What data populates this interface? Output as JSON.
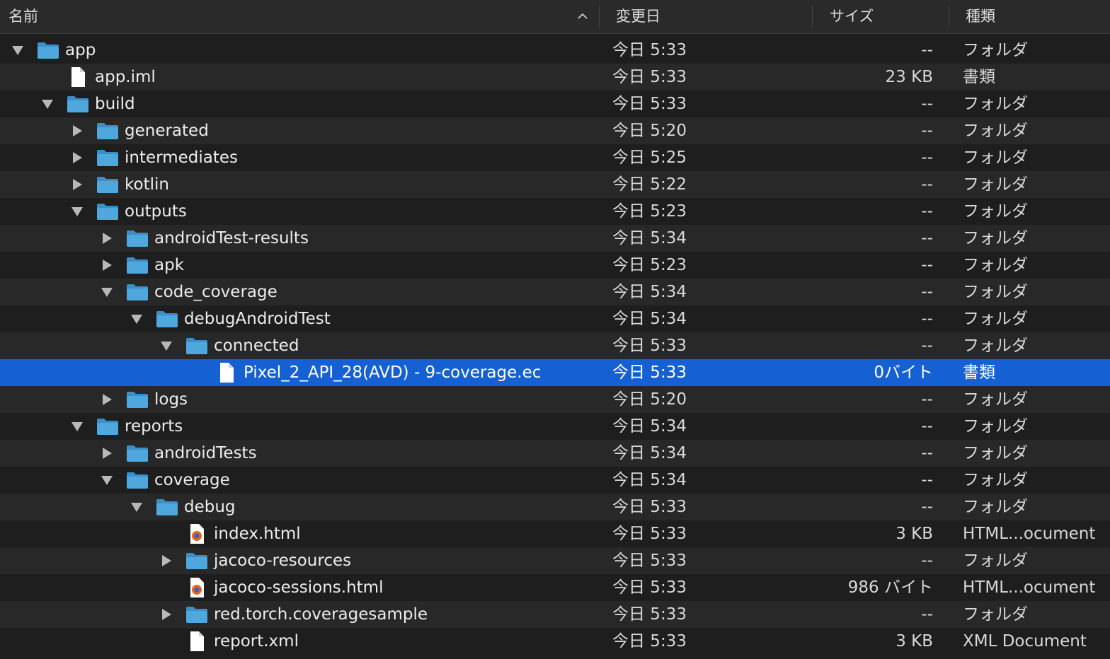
{
  "columns": {
    "name": "名前",
    "date": "変更日",
    "size": "サイズ",
    "kind": "種類"
  },
  "rows": [
    {
      "name": "app",
      "depth": 0,
      "icon": "folder-icon",
      "disclosure": "expanded",
      "date": "今日 5:33",
      "size": "--",
      "kind": "フォルダ"
    },
    {
      "name": "app.iml",
      "depth": 1,
      "icon": "document-icon",
      "disclosure": "none",
      "date": "今日 5:33",
      "size": "23 KB",
      "kind": "書類"
    },
    {
      "name": "build",
      "depth": 1,
      "icon": "folder-icon",
      "disclosure": "expanded",
      "date": "今日 5:33",
      "size": "--",
      "kind": "フォルダ"
    },
    {
      "name": "generated",
      "depth": 2,
      "icon": "folder-icon",
      "disclosure": "collapsed",
      "date": "今日 5:20",
      "size": "--",
      "kind": "フォルダ"
    },
    {
      "name": "intermediates",
      "depth": 2,
      "icon": "folder-icon",
      "disclosure": "collapsed",
      "date": "今日 5:25",
      "size": "--",
      "kind": "フォルダ"
    },
    {
      "name": "kotlin",
      "depth": 2,
      "icon": "folder-icon",
      "disclosure": "collapsed",
      "date": "今日 5:22",
      "size": "--",
      "kind": "フォルダ"
    },
    {
      "name": "outputs",
      "depth": 2,
      "icon": "folder-icon",
      "disclosure": "expanded",
      "date": "今日 5:23",
      "size": "--",
      "kind": "フォルダ"
    },
    {
      "name": "androidTest-results",
      "depth": 3,
      "icon": "folder-icon",
      "disclosure": "collapsed",
      "date": "今日 5:34",
      "size": "--",
      "kind": "フォルダ"
    },
    {
      "name": "apk",
      "depth": 3,
      "icon": "folder-icon",
      "disclosure": "collapsed",
      "date": "今日 5:23",
      "size": "--",
      "kind": "フォルダ"
    },
    {
      "name": "code_coverage",
      "depth": 3,
      "icon": "folder-icon",
      "disclosure": "expanded",
      "date": "今日 5:34",
      "size": "--",
      "kind": "フォルダ"
    },
    {
      "name": "debugAndroidTest",
      "depth": 4,
      "icon": "folder-icon",
      "disclosure": "expanded",
      "date": "今日 5:34",
      "size": "--",
      "kind": "フォルダ"
    },
    {
      "name": "connected",
      "depth": 5,
      "icon": "folder-icon",
      "disclosure": "expanded",
      "date": "今日 5:33",
      "size": "--",
      "kind": "フォルダ"
    },
    {
      "name": "Pixel_2_API_28(AVD) - 9-coverage.ec",
      "depth": 6,
      "icon": "document-icon",
      "disclosure": "none",
      "date": "今日 5:33",
      "size": "0バイト",
      "kind": "書類",
      "selected": true
    },
    {
      "name": "logs",
      "depth": 3,
      "icon": "folder-icon",
      "disclosure": "collapsed",
      "date": "今日 5:20",
      "size": "--",
      "kind": "フォルダ"
    },
    {
      "name": "reports",
      "depth": 2,
      "icon": "folder-icon",
      "disclosure": "expanded",
      "date": "今日 5:34",
      "size": "--",
      "kind": "フォルダ"
    },
    {
      "name": "androidTests",
      "depth": 3,
      "icon": "folder-icon",
      "disclosure": "collapsed",
      "date": "今日 5:34",
      "size": "--",
      "kind": "フォルダ"
    },
    {
      "name": "coverage",
      "depth": 3,
      "icon": "folder-icon",
      "disclosure": "expanded",
      "date": "今日 5:34",
      "size": "--",
      "kind": "フォルダ"
    },
    {
      "name": "debug",
      "depth": 4,
      "icon": "folder-icon",
      "disclosure": "expanded",
      "date": "今日 5:33",
      "size": "--",
      "kind": "フォルダ"
    },
    {
      "name": "index.html",
      "depth": 5,
      "icon": "firefox-html-icon",
      "disclosure": "none",
      "date": "今日 5:33",
      "size": "3 KB",
      "kind": "HTML...ocument"
    },
    {
      "name": "jacoco-resources",
      "depth": 5,
      "icon": "folder-icon",
      "disclosure": "collapsed",
      "date": "今日 5:33",
      "size": "--",
      "kind": "フォルダ"
    },
    {
      "name": "jacoco-sessions.html",
      "depth": 5,
      "icon": "firefox-html-icon",
      "disclosure": "none",
      "date": "今日 5:33",
      "size": "986 バイト",
      "kind": "HTML...ocument"
    },
    {
      "name": "red.torch.coveragesample",
      "depth": 5,
      "icon": "folder-icon",
      "disclosure": "collapsed",
      "date": "今日 5:33",
      "size": "--",
      "kind": "フォルダ"
    },
    {
      "name": "report.xml",
      "depth": 5,
      "icon": "document-icon",
      "disclosure": "none",
      "date": "今日 5:33",
      "size": "3 KB",
      "kind": "XML Document"
    }
  ],
  "colors": {
    "selection": "#1560d2",
    "folder": "#4ea8de"
  }
}
